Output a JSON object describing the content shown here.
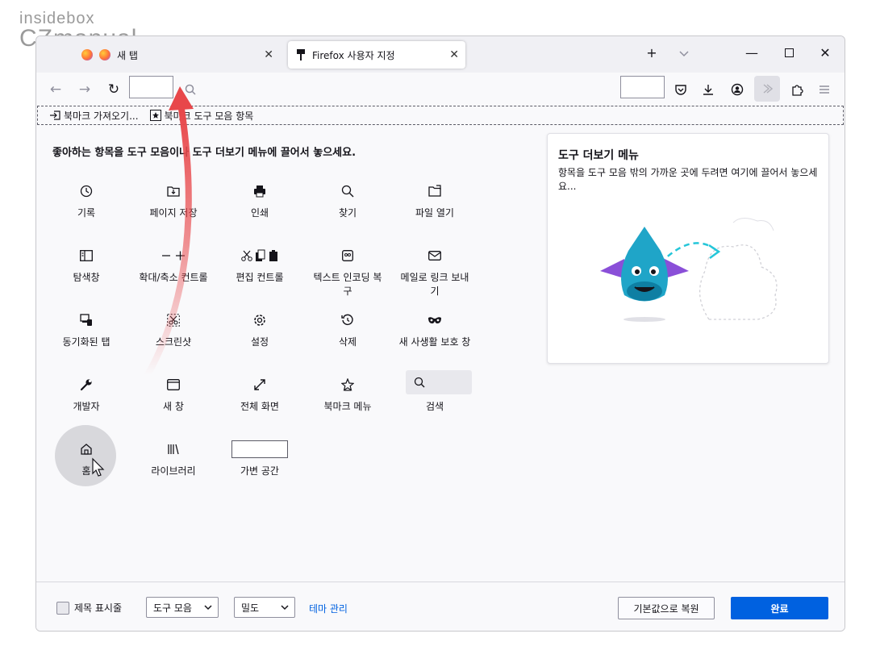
{
  "watermark": {
    "line1": "insidebox",
    "line2": "CZmanual"
  },
  "tabs": [
    {
      "label": "새 탭",
      "icon": "firefox-icon"
    },
    {
      "label": "Firefox 사용자 지정",
      "icon": "paintbrush-icon"
    }
  ],
  "bookmarks_toolbar": {
    "items": [
      {
        "label": "북마크 가져오기..."
      },
      {
        "label": "북마크 도구 모음 항목"
      }
    ]
  },
  "customize": {
    "heading": "좋아하는 항목을 도구 모음이나 도구 더보기 메뉴에 끌어서 놓으세요.",
    "items": [
      {
        "label": "기록",
        "icon": "history-icon"
      },
      {
        "label": "페이지 저장",
        "icon": "save-page-icon"
      },
      {
        "label": "인쇄",
        "icon": "print-icon"
      },
      {
        "label": "찾기",
        "icon": "find-icon"
      },
      {
        "label": "파일 열기",
        "icon": "open-file-icon"
      },
      {
        "label": "탐색창",
        "icon": "sidebar-icon"
      },
      {
        "label": "확대/축소 컨트롤",
        "icon": "zoom-controls-icon"
      },
      {
        "label": "편집 컨트롤",
        "icon": "edit-controls-icon"
      },
      {
        "label": "텍스트 인코딩 복구",
        "icon": "text-encoding-icon"
      },
      {
        "label": "메일로 링크 보내기",
        "icon": "mail-icon"
      },
      {
        "label": "동기화된 탭",
        "icon": "synced-tabs-icon"
      },
      {
        "label": "스크린샷",
        "icon": "screenshot-icon"
      },
      {
        "label": "설정",
        "icon": "settings-icon"
      },
      {
        "label": "삭제",
        "icon": "forget-icon"
      },
      {
        "label": "새 사생활 보호 창",
        "icon": "private-window-icon"
      },
      {
        "label": "개발자",
        "icon": "developer-icon"
      },
      {
        "label": "새 창",
        "icon": "new-window-icon"
      },
      {
        "label": "전체 화면",
        "icon": "fullscreen-icon"
      },
      {
        "label": "북마크 메뉴",
        "icon": "bookmark-menu-icon"
      },
      {
        "label": "검색",
        "icon": "search-icon"
      },
      {
        "label": "홈",
        "icon": "home-icon"
      },
      {
        "label": "라이브러리",
        "icon": "library-icon"
      },
      {
        "label": "가변 공간",
        "icon": "flexible-space-icon"
      }
    ]
  },
  "overflow_panel": {
    "title": "도구 더보기 메뉴",
    "description": "항목을 도구 모음 밖의 가까운 곳에 두려면 여기에 끌어서 놓으세요..."
  },
  "footer": {
    "title_bar_checkbox": "제목 표시줄",
    "toolbars_select": "도구 모음",
    "density_select": "밀도",
    "manage_themes": "테마 관리",
    "restore_defaults": "기본값으로 복원",
    "done": "완료"
  },
  "colors": {
    "accent": "#0061e0",
    "link": "#0061e0",
    "arrow": "#e8474a"
  }
}
